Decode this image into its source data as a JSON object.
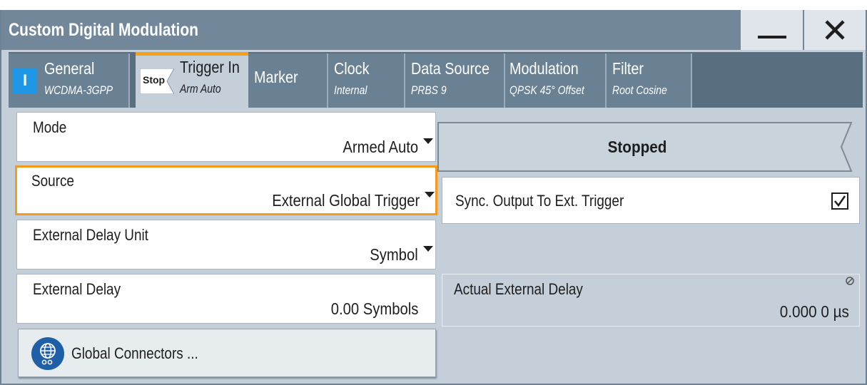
{
  "window": {
    "title": "Custom Digital Modulation",
    "minimize_icon": "minimize-icon",
    "close_icon": "close-icon"
  },
  "tabs": [
    {
      "label": "General",
      "sub": "WCDMA-3GPP",
      "state_icon": "info-state-icon",
      "state_text": "I"
    },
    {
      "label": "Trigger In",
      "sub": "Arm Auto",
      "state_icon": "stop-state-icon",
      "state_text": "Stop",
      "active": true
    },
    {
      "label": "Marker",
      "sub": ""
    },
    {
      "label": "Clock",
      "sub": "Internal"
    },
    {
      "label": "Data Source",
      "sub": "PRBS 9"
    },
    {
      "label": "Modulation",
      "sub": "QPSK 45° Offset"
    },
    {
      "label": "Filter",
      "sub": "Root Cosine"
    }
  ],
  "mode": {
    "label": "Mode",
    "value": "Armed Auto"
  },
  "status": {
    "text": "Stopped"
  },
  "source": {
    "label": "Source",
    "value": "External Global Trigger"
  },
  "sync": {
    "label": "Sync. Output To Ext. Trigger",
    "checked": true
  },
  "delay_unit": {
    "label": "External Delay Unit",
    "value": "Symbol"
  },
  "ext_delay": {
    "label": "External Delay",
    "value": "0.00  Symbols"
  },
  "actual_delay": {
    "label": "Actual External Delay",
    "value": "0.000 0 µs",
    "icon": "read-only-icon"
  },
  "global_connectors": {
    "label": "Global Connectors ...",
    "icon": "globe-connectors-icon"
  },
  "colors": {
    "accent": "#f59a1c",
    "titlebar": "#72889a",
    "tabbar": "#586f82",
    "panel": "#c4cfd9",
    "info_blue": "#1e97e6"
  }
}
